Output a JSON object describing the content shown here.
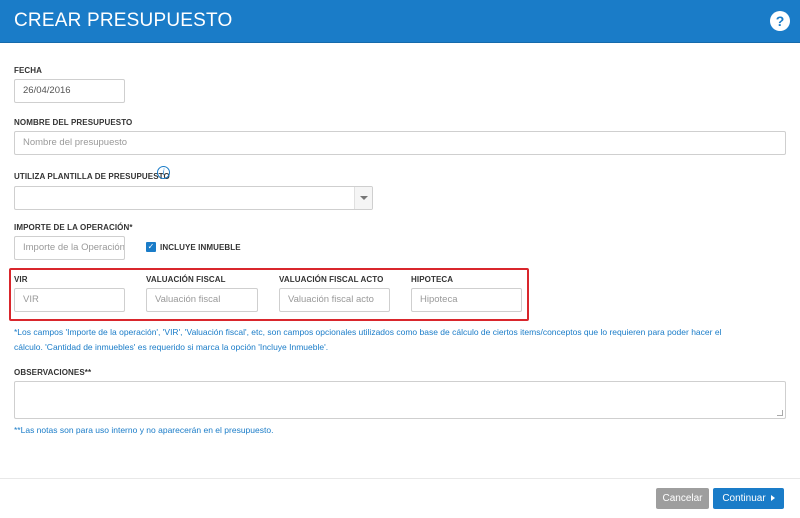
{
  "header": {
    "title": "CREAR PRESUPUESTO",
    "help_icon": "question-circle-icon"
  },
  "fecha": {
    "label": "FECHA",
    "value": "26/04/2016"
  },
  "nombre": {
    "label": "NOMBRE DEL PRESUPUESTO",
    "placeholder": "Nombre del presupuesto"
  },
  "plantilla": {
    "label": "UTILIZA PLANTILLA DE PRESUPUESTO",
    "info_icon": "info-icon",
    "selected": ""
  },
  "importe": {
    "label": "IMPORTE DE LA OPERACIÓN*",
    "placeholder": "Importe de la Operación",
    "checkbox_label": "INCLUYE INMUEBLE",
    "checked": true
  },
  "valuaciones": [
    {
      "label": "VIR",
      "placeholder": "VIR"
    },
    {
      "label": "VALUACIÓN FISCAL",
      "placeholder": "Valuación fiscal"
    },
    {
      "label": "VALUACIÓN FISCAL ACTO",
      "placeholder": "Valuación fiscal acto"
    },
    {
      "label": "HIPOTECA",
      "placeholder": "Hipoteca"
    }
  ],
  "notes": {
    "optional_line1": "*Los campos 'Importe de la operación', 'VIR', 'Valuación fiscal', etc, son campos opcionales utilizados como base de cálculo de ciertos items/conceptos que lo requieren para poder hacer el",
    "optional_line2": "cálculo. 'Cantidad de inmuebles' es requerido si marca la opción 'Incluye Inmueble'.",
    "internal": "**Las notas son para uso interno y no aparecerán en el presupuesto."
  },
  "observaciones": {
    "label": "OBSERVACIONES**",
    "value": ""
  },
  "footer": {
    "cancel_label": "Cancelar",
    "continue_label": "Continuar"
  },
  "colors": {
    "primary": "#1a7cc8",
    "highlight": "#d9262c",
    "cancel": "#9e9e9e"
  }
}
